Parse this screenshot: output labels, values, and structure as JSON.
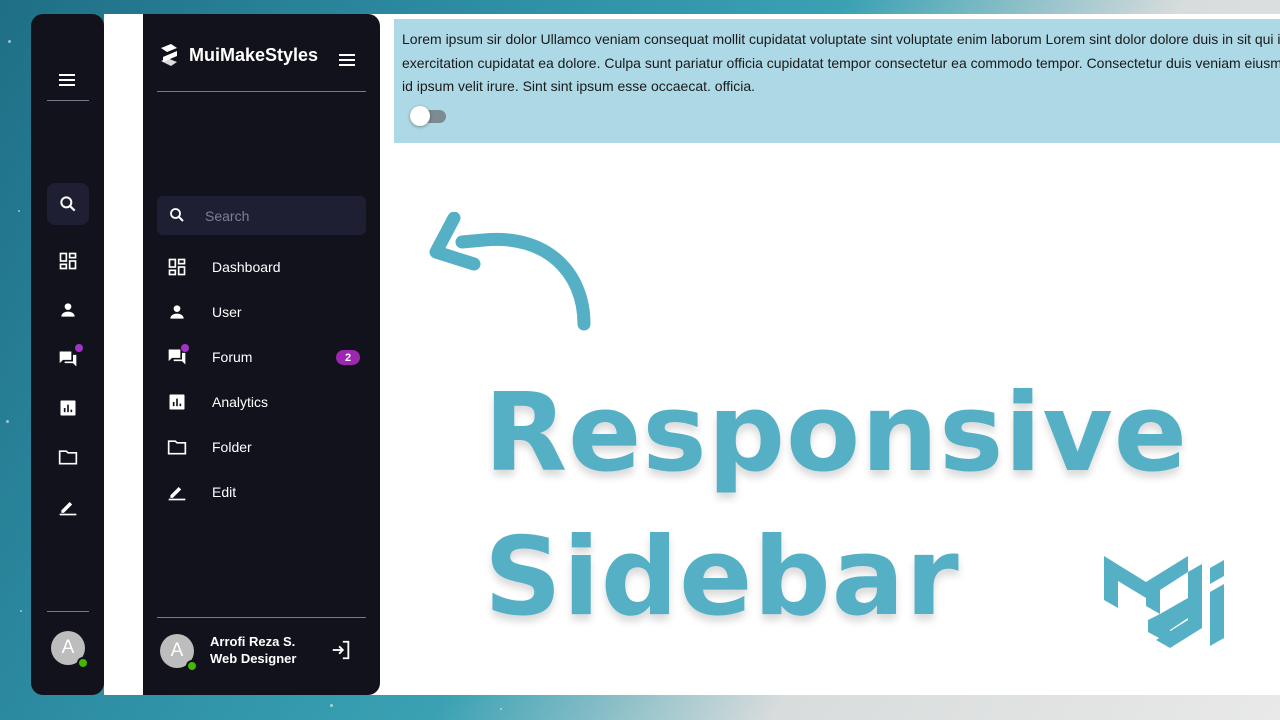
{
  "brand": {
    "name": "MuiMakeStyles"
  },
  "search": {
    "placeholder": "Search"
  },
  "nav": [
    {
      "label": "Dashboard",
      "icon": "dashboard-icon"
    },
    {
      "label": "User",
      "icon": "user-icon"
    },
    {
      "label": "Forum",
      "icon": "forum-icon",
      "badge": "2"
    },
    {
      "label": "Analytics",
      "icon": "analytics-icon"
    },
    {
      "label": "Folder",
      "icon": "folder-icon"
    },
    {
      "label": "Edit",
      "icon": "edit-icon"
    }
  ],
  "profile": {
    "initial": "A",
    "name": "Arrofi Reza S.",
    "role": "Web Designer",
    "status": "online"
  },
  "panel": {
    "text": "Lorem ipsum sir dolor Ullamco veniam consequat mollit cupidatat voluptate sint voluptate enim laborum Lorem sint dolor dolore duis in sit qui in exercitation cupidatat ea dolore. Culpa sunt pariatur officia cupidatat tempor consectetur ea commodo tempor. Consectetur duis veniam eiusmod id ipsum velit irure. Sint sint ipsum esse occaecat. officia.",
    "switch_on": false
  },
  "headline": {
    "line1": "Responsive",
    "line2": "Sidebar"
  },
  "colors": {
    "sidebar_bg": "#12121d",
    "search_bg": "#1e1f33",
    "badge": "#9c27b0",
    "accent": "#55b0c5",
    "panel_bg": "#add8e6",
    "online": "#44b700"
  }
}
